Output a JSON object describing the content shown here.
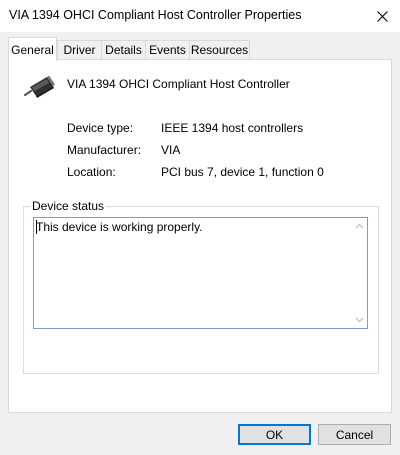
{
  "window": {
    "title": "VIA 1394 OHCI Compliant Host Controller Properties"
  },
  "tabs": [
    {
      "label": "General",
      "active": true
    },
    {
      "label": "Driver",
      "active": false
    },
    {
      "label": "Details",
      "active": false
    },
    {
      "label": "Events",
      "active": false
    },
    {
      "label": "Resources",
      "active": false
    }
  ],
  "device": {
    "name": "VIA 1394 OHCI Compliant Host Controller",
    "icon": "firewire-connector-icon"
  },
  "properties": [
    {
      "label": "Device type:",
      "value": "IEEE 1394 host controllers"
    },
    {
      "label": "Manufacturer:",
      "value": "VIA"
    },
    {
      "label": "Location:",
      "value": "PCI bus 7, device 1, function 0"
    }
  ],
  "device_status": {
    "legend": "Device status",
    "text": "This device is working properly."
  },
  "buttons": {
    "ok": "OK",
    "cancel": "Cancel"
  },
  "colors": {
    "focus_border": "#0078d7",
    "textbox_border": "#7a9ecf",
    "panel_background": "#ffffff",
    "window_background": "#f0f0f0"
  }
}
